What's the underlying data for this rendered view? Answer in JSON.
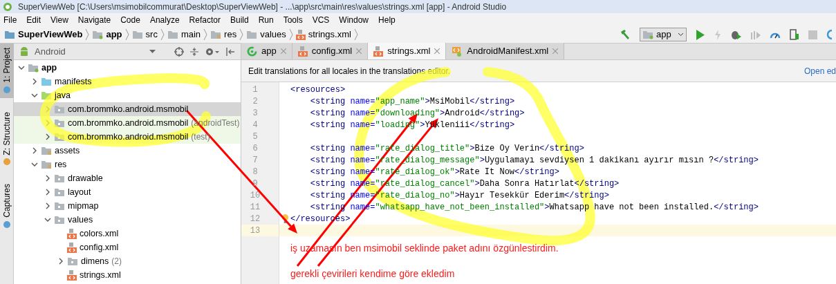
{
  "window": {
    "title": "SuperViewWeb [C:\\Users\\msimobilcommurat\\Desktop\\SuperViewWeb] - ...\\app\\src\\main\\res\\values\\strings.xml [app] - Android Studio"
  },
  "menu": [
    "File",
    "Edit",
    "View",
    "Navigate",
    "Code",
    "Analyze",
    "Refactor",
    "Build",
    "Run",
    "Tools",
    "VCS",
    "Window",
    "Help"
  ],
  "breadcrumbs": [
    {
      "label": "SuperViewWeb",
      "kind": "project"
    },
    {
      "label": "app",
      "kind": "module"
    },
    {
      "label": "src",
      "kind": "folder"
    },
    {
      "label": "main",
      "kind": "folder"
    },
    {
      "label": "res",
      "kind": "res"
    },
    {
      "label": "values",
      "kind": "folder"
    },
    {
      "label": "strings.xml",
      "kind": "xml"
    }
  ],
  "toolbar": {
    "run_config": "app"
  },
  "side_tabs": [
    {
      "label": "1: Project",
      "selected": true
    },
    {
      "label": "Z: Structure",
      "selected": false
    },
    {
      "label": "Captures",
      "selected": false
    }
  ],
  "project_panel": {
    "view": "Android",
    "tree": [
      {
        "label": "app",
        "kind": "module",
        "selected": false,
        "expanded": true,
        "children": [
          {
            "label": "manifests",
            "kind": "manifest-folder",
            "selected": false,
            "expanded": false
          },
          {
            "label": "java",
            "kind": "java-folder",
            "selected": false,
            "expanded": true,
            "children": [
              {
                "label": "com.brommko.android.msmobil",
                "kind": "package",
                "selected": true,
                "expanded": false,
                "test": false
              },
              {
                "label": "com.brommko.android.msmobil",
                "suffix": "(androidTest)",
                "kind": "package",
                "selected": false,
                "expanded": false,
                "test": true
              },
              {
                "label": "com.brommko.android.msmobil",
                "suffix": "(test)",
                "kind": "package",
                "selected": false,
                "expanded": false,
                "test": true
              }
            ]
          },
          {
            "label": "assets",
            "kind": "res-folder",
            "selected": false,
            "expanded": false
          },
          {
            "label": "res",
            "kind": "res-folder",
            "selected": false,
            "expanded": true,
            "children": [
              {
                "label": "drawable",
                "kind": "package",
                "selected": false,
                "expanded": false
              },
              {
                "label": "layout",
                "kind": "package",
                "selected": false,
                "expanded": false
              },
              {
                "label": "mipmap",
                "kind": "package",
                "selected": false,
                "expanded": false
              },
              {
                "label": "values",
                "kind": "package",
                "selected": false,
                "expanded": true,
                "children": [
                  {
                    "label": "colors.xml",
                    "kind": "xml",
                    "selected": false
                  },
                  {
                    "label": "config.xml",
                    "kind": "xml",
                    "selected": false
                  },
                  {
                    "label": "dimens",
                    "suffix": "(2)",
                    "kind": "package",
                    "selected": false,
                    "expanded": false
                  },
                  {
                    "label": "strings.xml",
                    "kind": "xml",
                    "selected": false
                  }
                ]
              }
            ]
          }
        ]
      }
    ]
  },
  "editor_tabs": [
    {
      "label": "app",
      "kind": "run",
      "selected": false
    },
    {
      "label": "config.xml",
      "kind": "xml",
      "selected": false
    },
    {
      "label": "strings.xml",
      "kind": "xml",
      "selected": true
    },
    {
      "label": "AndroidManifest.xml",
      "kind": "manifest",
      "selected": false
    }
  ],
  "notice": {
    "text": "Edit translations for all locales in the translations editor.",
    "link": "Open ed"
  },
  "code": {
    "lines": [
      {
        "number": "1",
        "current": false,
        "bulb": false,
        "tokens": [
          {
            "text": "<resources>",
            "kind": "tag"
          }
        ]
      },
      {
        "number": "2",
        "current": false,
        "bulb": false,
        "tokens": [
          {
            "text": "    <string",
            "kind": "tag"
          },
          {
            "text": " name=",
            "kind": "attr"
          },
          {
            "text": "\"app_name\"",
            "kind": "value"
          },
          {
            "text": ">",
            "kind": "tag"
          },
          {
            "text": "MsiMobil",
            "kind": "text"
          },
          {
            "text": "</string>",
            "kind": "tag"
          }
        ]
      },
      {
        "number": "3",
        "current": false,
        "bulb": false,
        "tokens": [
          {
            "text": "    <string",
            "kind": "tag"
          },
          {
            "text": " name=",
            "kind": "attr"
          },
          {
            "text": "\"downloading\"",
            "kind": "value"
          },
          {
            "text": ">",
            "kind": "tag"
          },
          {
            "text": "Android",
            "kind": "text"
          },
          {
            "text": "</string>",
            "kind": "tag"
          }
        ]
      },
      {
        "number": "4",
        "current": false,
        "bulb": false,
        "tokens": [
          {
            "text": "    <string",
            "kind": "tag"
          },
          {
            "text": " name=",
            "kind": "attr"
          },
          {
            "text": "\"loading\"",
            "kind": "value"
          },
          {
            "text": ">",
            "kind": "tag"
          },
          {
            "text": "Yükleniii",
            "kind": "text"
          },
          {
            "text": "</string>",
            "kind": "tag"
          }
        ]
      },
      {
        "number": "5",
        "current": false,
        "bulb": false
      },
      {
        "number": "6",
        "current": false,
        "bulb": false,
        "tokens": [
          {
            "text": "    <string",
            "kind": "tag"
          },
          {
            "text": " name=",
            "kind": "attr"
          },
          {
            "text": "\"rate_dialog_title\"",
            "kind": "value"
          },
          {
            "text": ">",
            "kind": "tag"
          },
          {
            "text": "Bize Oy Verin",
            "kind": "text"
          },
          {
            "text": "</string>",
            "kind": "tag"
          }
        ]
      },
      {
        "number": "7",
        "current": false,
        "bulb": false,
        "tokens": [
          {
            "text": "    <string",
            "kind": "tag"
          },
          {
            "text": " name=",
            "kind": "attr"
          },
          {
            "text": "\"rate_dialog_message\"",
            "kind": "value"
          },
          {
            "text": ">",
            "kind": "tag"
          },
          {
            "text": "Uygulamayı sevdiysen 1 dakikanı ayırır mısın ?",
            "kind": "text"
          },
          {
            "text": "</string>",
            "kind": "tag"
          }
        ]
      },
      {
        "number": "8",
        "current": false,
        "bulb": false,
        "tokens": [
          {
            "text": "    <string",
            "kind": "tag"
          },
          {
            "text": " name=",
            "kind": "attr"
          },
          {
            "text": "\"rate_dialog_ok\"",
            "kind": "value"
          },
          {
            "text": ">",
            "kind": "tag"
          },
          {
            "text": "Rate It Now",
            "kind": "text"
          },
          {
            "text": "</string>",
            "kind": "tag"
          }
        ]
      },
      {
        "number": "9",
        "current": false,
        "bulb": false,
        "tokens": [
          {
            "text": "    <string",
            "kind": "tag"
          },
          {
            "text": " name=",
            "kind": "attr"
          },
          {
            "text": "\"rate_dialog_cancel\"",
            "kind": "value"
          },
          {
            "text": ">",
            "kind": "tag"
          },
          {
            "text": "Daha Sonra Hatırlat",
            "kind": "text"
          },
          {
            "text": "</string>",
            "kind": "tag"
          }
        ]
      },
      {
        "number": "10",
        "current": false,
        "bulb": false,
        "tokens": [
          {
            "text": "    <string",
            "kind": "tag"
          },
          {
            "text": " name=",
            "kind": "attr"
          },
          {
            "text": "\"rate_dialog_no\"",
            "kind": "value"
          },
          {
            "text": ">",
            "kind": "tag"
          },
          {
            "text": "Hayır Tesekkür Ederim",
            "kind": "text"
          },
          {
            "text": "</string>",
            "kind": "tag"
          }
        ]
      },
      {
        "number": "11",
        "current": false,
        "bulb": false,
        "tokens": [
          {
            "text": "    <string",
            "kind": "tag"
          },
          {
            "text": " name=",
            "kind": "attr"
          },
          {
            "text": "\"whatsapp_have_not_been_installed\"",
            "kind": "value"
          },
          {
            "text": ">",
            "kind": "tag"
          },
          {
            "text": "Whatsapp have not been installed.",
            "kind": "text"
          },
          {
            "text": "</string>",
            "kind": "tag"
          }
        ]
      },
      {
        "number": "12",
        "current": false,
        "bulb": true,
        "tokens": [
          {
            "text": "</resources>",
            "kind": "tag"
          }
        ]
      },
      {
        "number": "13",
        "current": true,
        "bulb": false
      }
    ]
  },
  "annotations": [
    {
      "text": "iş uzamasın ben msimobil seklinde paket adını özgünlestirdim."
    },
    {
      "text": "gerekli çevirileri kendime göre ekledim"
    }
  ]
}
